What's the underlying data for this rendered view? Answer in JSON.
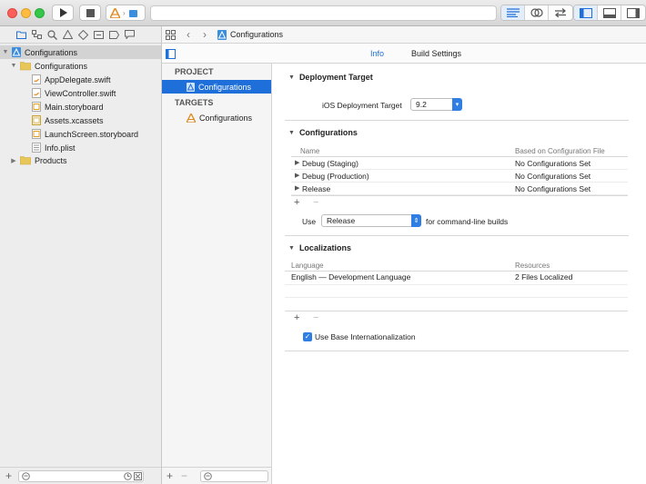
{
  "toolbar": {
    "scheme_name": "",
    "colors": {
      "close": "#fc605c",
      "minimize": "#fdbc40",
      "zoom": "#34c84a",
      "accent": "#1e6fd9"
    }
  },
  "navigator": {
    "project_name": "Configurations",
    "group_name": "Configurations",
    "files": [
      {
        "name": "AppDelegate.swift",
        "icon": "swift-file-icon"
      },
      {
        "name": "ViewController.swift",
        "icon": "swift-file-icon"
      },
      {
        "name": "Main.storyboard",
        "icon": "storyboard-file-icon"
      },
      {
        "name": "Assets.xcassets",
        "icon": "asset-catalog-icon"
      },
      {
        "name": "LaunchScreen.storyboard",
        "icon": "storyboard-file-icon"
      },
      {
        "name": "Info.plist",
        "icon": "plist-file-icon"
      }
    ],
    "products_label": "Products"
  },
  "jumpbar": {
    "label": "Configurations"
  },
  "editor_tabs": {
    "info": "Info",
    "build_settings": "Build Settings"
  },
  "project_list": {
    "project_header": "PROJECT",
    "project_item": "Configurations",
    "targets_header": "TARGETS",
    "target_item": "Configurations"
  },
  "deployment": {
    "title": "Deployment Target",
    "label": "iOS Deployment Target",
    "value": "9.2"
  },
  "configurations": {
    "title": "Configurations",
    "col_name": "Name",
    "col_based_on": "Based on Configuration File",
    "rows": [
      {
        "name": "Debug (Staging)",
        "based_on": "No Configurations Set"
      },
      {
        "name": "Debug (Production)",
        "based_on": "No Configurations Set"
      },
      {
        "name": "Release",
        "based_on": "No Configurations Set"
      }
    ],
    "use_label": "Use",
    "use_value": "Release",
    "use_suffix": "for command-line builds"
  },
  "localizations": {
    "title": "Localizations",
    "col_language": "Language",
    "col_resources": "Resources",
    "rows": [
      {
        "language": "English — Development Language",
        "resources": "2 Files Localized"
      }
    ],
    "base_intl_label": "Use Base Internationalization",
    "base_intl_checked": true
  }
}
